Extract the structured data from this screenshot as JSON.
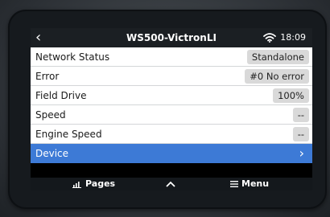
{
  "topbar": {
    "back_glyph": "‹",
    "title": "WS500-VictronLI",
    "time": "18:09",
    "wifi_icon": "wifi-icon"
  },
  "rows": [
    {
      "label": "Network Status",
      "value": "Standalone"
    },
    {
      "label": "Error",
      "value": "#0 No error"
    },
    {
      "label": "Field Drive",
      "value": "100%"
    },
    {
      "label": "Speed",
      "value": "--"
    },
    {
      "label": "Engine Speed",
      "value": "--"
    }
  ],
  "selected_row": {
    "label": "Device",
    "chevron": "›"
  },
  "bottombar": {
    "pages_label": "Pages",
    "up_glyph": "^",
    "menu_label": "Menu"
  },
  "colors": {
    "selected": "#3d7ad6",
    "value_bg": "#d9d9d9",
    "topbar": "#1b1f23"
  }
}
